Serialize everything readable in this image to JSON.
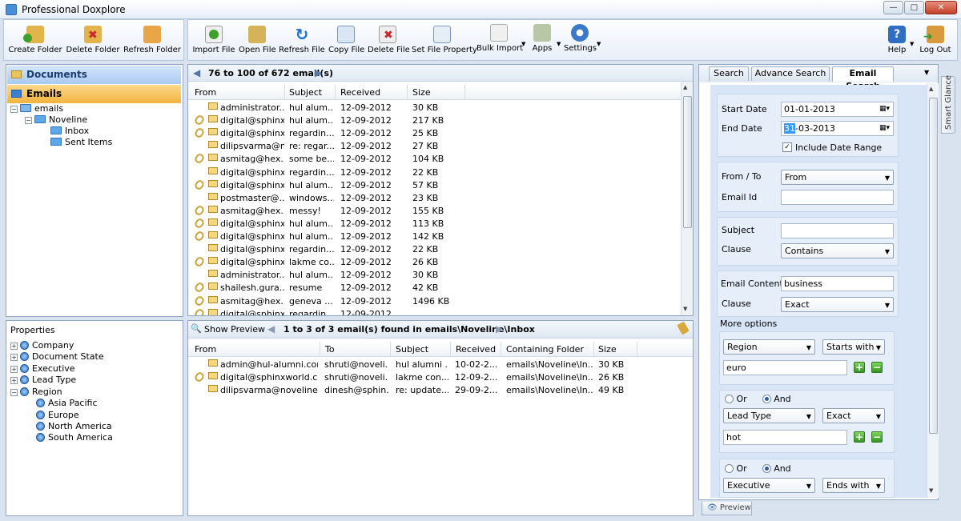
{
  "window": {
    "title": "Professional Doxplore"
  },
  "toolbar_left": [
    {
      "label": "Create Folder"
    },
    {
      "label": "Delete Folder"
    },
    {
      "label": "Refresh Folder"
    }
  ],
  "toolbar_main": [
    {
      "label": "Import File"
    },
    {
      "label": "Open File"
    },
    {
      "label": "Refresh File"
    },
    {
      "label": "Copy File"
    },
    {
      "label": "Delete File"
    },
    {
      "label": "Set File Property"
    },
    {
      "label": "Bulk Import"
    },
    {
      "label": "Apps"
    },
    {
      "label": "Settings"
    }
  ],
  "toolbar_right": [
    {
      "label": "Help"
    },
    {
      "label": "Log Out"
    }
  ],
  "nav": {
    "documents": "Documents",
    "emails": "Emails",
    "tree": [
      "emails",
      "Noveline",
      "Inbox",
      "Sent Items"
    ]
  },
  "properties": {
    "title": "Properties",
    "items": [
      "Company",
      "Document State",
      "Executive",
      "Lead Type",
      "Region"
    ],
    "region_children": [
      "Asia Pacific",
      "Europe",
      "North America",
      "South America"
    ]
  },
  "email_list": {
    "pager": "76 to 100 of 672 email(s)",
    "columns": [
      "From",
      "Subject",
      "Received",
      "Size"
    ],
    "rows": [
      {
        "from": "administrator...",
        "subject": "hul alum...",
        "received": "12-09-2012",
        "size": "30 KB",
        "attach": false
      },
      {
        "from": "digital@sphinx...",
        "subject": "hul alum...",
        "received": "12-09-2012",
        "size": "217 KB",
        "attach": true
      },
      {
        "from": "digital@sphinx...",
        "subject": "regardin...",
        "received": "12-09-2012",
        "size": "25 KB",
        "attach": true
      },
      {
        "from": "dilipsvarma@n...",
        "subject": "re: regar...",
        "received": "12-09-2012",
        "size": "27 KB",
        "attach": false
      },
      {
        "from": "asmitag@hex...",
        "subject": "some be...",
        "received": "12-09-2012",
        "size": "104 KB",
        "attach": true
      },
      {
        "from": "digital@sphinx...",
        "subject": "regardin...",
        "received": "12-09-2012",
        "size": "22 KB",
        "attach": false
      },
      {
        "from": "digital@sphinx...",
        "subject": "hul alum...",
        "received": "12-09-2012",
        "size": "57 KB",
        "attach": true
      },
      {
        "from": "postmaster@...",
        "subject": "windows...",
        "received": "12-09-2012",
        "size": "23 KB",
        "attach": false
      },
      {
        "from": "asmitag@hex...",
        "subject": "messy!",
        "received": "12-09-2012",
        "size": "155 KB",
        "attach": true
      },
      {
        "from": "digital@sphinx...",
        "subject": "hul alum...",
        "received": "12-09-2012",
        "size": "113 KB",
        "attach": true
      },
      {
        "from": "digital@sphinx...",
        "subject": "hul alum...",
        "received": "12-09-2012",
        "size": "142 KB",
        "attach": true
      },
      {
        "from": "digital@sphinx...",
        "subject": "regardin...",
        "received": "12-09-2012",
        "size": "22 KB",
        "attach": false
      },
      {
        "from": "digital@sphinx...",
        "subject": "lakme co...",
        "received": "12-09-2012",
        "size": "26 KB",
        "attach": true
      },
      {
        "from": "administrator...",
        "subject": "hul alum...",
        "received": "12-09-2012",
        "size": "30 KB",
        "attach": false
      },
      {
        "from": "shailesh.gura...",
        "subject": "resume",
        "received": "12-09-2012",
        "size": "42 KB",
        "attach": true
      },
      {
        "from": "asmitag@hex...",
        "subject": "geneva ...",
        "received": "12-09-2012",
        "size": "1496 KB",
        "attach": true
      },
      {
        "from": "digital@sphinx...",
        "subject": "regardin...",
        "received": "12-09-2012",
        "size": "",
        "attach": true
      }
    ]
  },
  "preview": {
    "show_preview": "Show Preview",
    "result": "1 to 3 of 3 email(s) found in emails\\Noveline\\Inbox",
    "columns": [
      "From",
      "To",
      "Subject",
      "Received",
      "Containing Folder",
      "Size"
    ],
    "rows": [
      {
        "from": "admin@hul-alumni.com",
        "to": "shruti@noveli...",
        "subject": "hul alumni ...",
        "received": "10-02-2...",
        "folder": "emails\\Noveline\\In...",
        "size": "30 KB",
        "attach": false
      },
      {
        "from": "digital@sphinxworld.com",
        "to": "shruti@noveli...",
        "subject": "lakme con...",
        "received": "12-09-2...",
        "folder": "emails\\Noveline\\In...",
        "size": "26 KB",
        "attach": true
      },
      {
        "from": "dilipsvarma@noveline.c...",
        "to": "dinesh@sphin...",
        "subject": "re: update...",
        "received": "29-09-2...",
        "folder": "emails\\Noveline\\In...",
        "size": "49 KB",
        "attach": false
      }
    ]
  },
  "search": {
    "tabs": [
      "Search",
      "Advance Search",
      "Email Search"
    ],
    "active_tab": "Email Search",
    "start_date_label": "Start Date",
    "start_date": "01-01-2013",
    "end_date_label": "End Date",
    "end_date_highlight": "31",
    "end_date_rest": "-03-2013",
    "include_date_range": "Include Date Range",
    "from_to_label": "From / To",
    "from_to_value": "From",
    "email_id_label": "Email Id",
    "email_id_value": "",
    "subject_label": "Subject",
    "subject_value": "",
    "clause_label": "Clause",
    "subject_clause": "Contains",
    "content_label": "Email Content",
    "content_value": "business",
    "content_clause": "Exact",
    "more_options": "More options",
    "option1": {
      "property": "Region",
      "op": "Starts with",
      "value": "euro"
    },
    "or_label": "Or",
    "and_label": "And",
    "option2": {
      "property": "Lead Type",
      "op": "Exact",
      "value": "hot"
    },
    "option3": {
      "property": "Executive",
      "op": "Ends with"
    },
    "smart_glance": "Smart Glance",
    "preview_tab": "Preview"
  },
  "colors": {
    "accent_orange": "#f6b94a",
    "nav_blue": "#bcd6f5",
    "panel_bg": "#d9e3ef"
  }
}
